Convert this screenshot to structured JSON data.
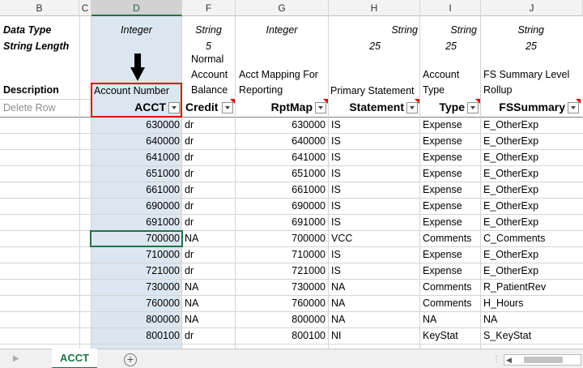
{
  "columns": [
    {
      "id": "B",
      "label": "B"
    },
    {
      "id": "C",
      "label": "C"
    },
    {
      "id": "D",
      "label": "D"
    },
    {
      "id": "F",
      "label": "F"
    },
    {
      "id": "G",
      "label": "G"
    },
    {
      "id": "H",
      "label": "H"
    },
    {
      "id": "I",
      "label": "I"
    },
    {
      "id": "J",
      "label": "J"
    }
  ],
  "meta": {
    "data_type_label": "Data Type",
    "string_length_label": "String Length",
    "description_label": "Description",
    "delete_row_label": "Delete Row",
    "datatypes": {
      "D": "Integer",
      "F": "String",
      "G": "Integer",
      "H": "String",
      "I": "String",
      "J": "String"
    },
    "lengths": {
      "F": "5",
      "H": "25",
      "I": "25",
      "J": "25"
    },
    "descriptions": {
      "D": "Account Number",
      "F": [
        "Normal",
        "Account",
        "Balance"
      ],
      "G": [
        "Acct Mapping For",
        "Reporting"
      ],
      "H": "Primary Statement",
      "I": [
        "Account",
        "Type"
      ],
      "J": [
        "FS Summary Level",
        "Rollup"
      ]
    },
    "headers": {
      "D": "ACCT",
      "F": "Credit",
      "G": "RptMap",
      "H": "Statement",
      "I": "Type",
      "J": "FSSummary"
    }
  },
  "rows": [
    {
      "acct": "630000",
      "credit": "dr",
      "rptmap": "630000",
      "statement": "IS",
      "type": "Expense",
      "fssummary": "E_OtherExp"
    },
    {
      "acct": "640000",
      "credit": "dr",
      "rptmap": "640000",
      "statement": "IS",
      "type": "Expense",
      "fssummary": "E_OtherExp"
    },
    {
      "acct": "641000",
      "credit": "dr",
      "rptmap": "641000",
      "statement": "IS",
      "type": "Expense",
      "fssummary": "E_OtherExp"
    },
    {
      "acct": "651000",
      "credit": "dr",
      "rptmap": "651000",
      "statement": "IS",
      "type": "Expense",
      "fssummary": "E_OtherExp"
    },
    {
      "acct": "661000",
      "credit": "dr",
      "rptmap": "661000",
      "statement": "IS",
      "type": "Expense",
      "fssummary": "E_OtherExp"
    },
    {
      "acct": "690000",
      "credit": "dr",
      "rptmap": "690000",
      "statement": "IS",
      "type": "Expense",
      "fssummary": "E_OtherExp"
    },
    {
      "acct": "691000",
      "credit": "dr",
      "rptmap": "691000",
      "statement": "IS",
      "type": "Expense",
      "fssummary": "E_OtherExp"
    },
    {
      "acct": "700000",
      "credit": "NA",
      "rptmap": "700000",
      "statement": "VCC",
      "type": "Comments",
      "fssummary": "C_Comments"
    },
    {
      "acct": "710000",
      "credit": "dr",
      "rptmap": "710000",
      "statement": "IS",
      "type": "Expense",
      "fssummary": "E_OtherExp"
    },
    {
      "acct": "721000",
      "credit": "dr",
      "rptmap": "721000",
      "statement": "IS",
      "type": "Expense",
      "fssummary": "E_OtherExp"
    },
    {
      "acct": "730000",
      "credit": "NA",
      "rptmap": "730000",
      "statement": "NA",
      "type": "Comments",
      "fssummary": "R_PatientRev"
    },
    {
      "acct": "760000",
      "credit": "NA",
      "rptmap": "760000",
      "statement": "NA",
      "type": "Comments",
      "fssummary": "H_Hours"
    },
    {
      "acct": "800000",
      "credit": "NA",
      "rptmap": "800000",
      "statement": "NA",
      "type": "NA",
      "fssummary": "NA"
    },
    {
      "acct": "800100",
      "credit": "dr",
      "rptmap": "800100",
      "statement": "NI",
      "type": "KeyStat",
      "fssummary": "S_KeyStat"
    }
  ],
  "sheet_tab": "ACCT",
  "add_sheet_icon": "plus-circle-icon",
  "arrow_icon": "down-arrow-icon",
  "colors": {
    "selected_column": "#dce6f1",
    "highlight_border": "#e00000",
    "active_cell": "#217346",
    "tab_accent": "#217346"
  }
}
